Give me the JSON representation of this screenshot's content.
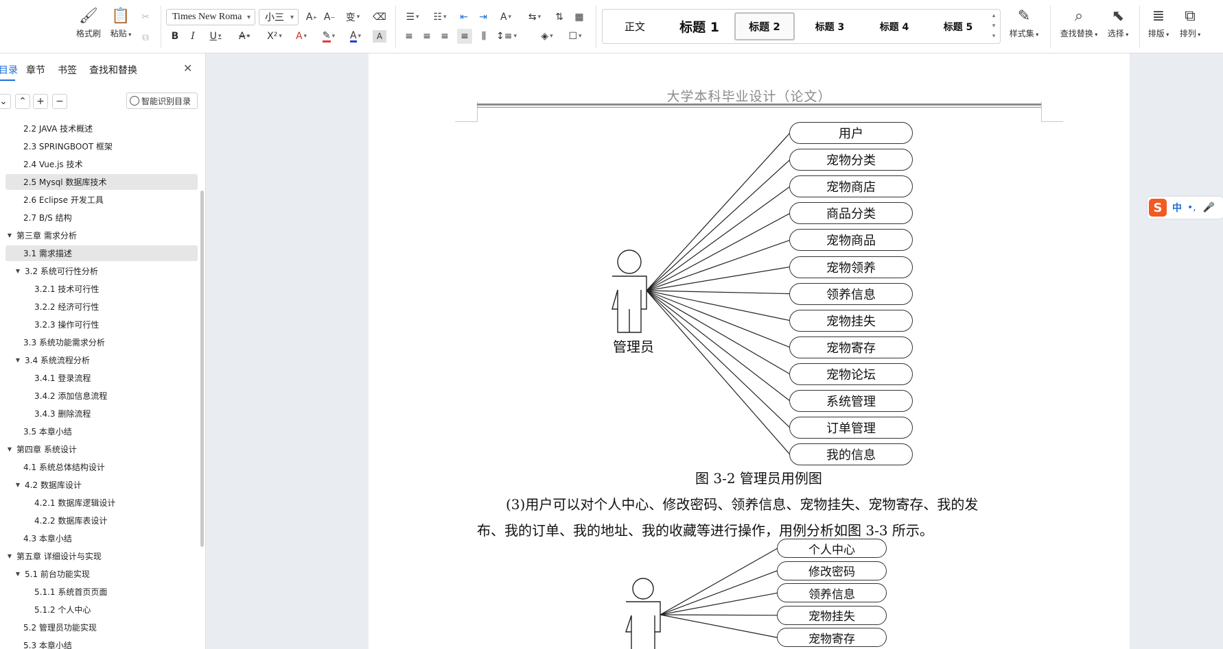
{
  "ribbon": {
    "format_painter": "格式刷",
    "paste": "粘贴",
    "font_name": "Times New Roma",
    "font_size": "小三",
    "styles": [
      "正文",
      "标题 1",
      "标题 2",
      "标题 3",
      "标题 4",
      "标题 5"
    ],
    "style_set": "样式集",
    "find_replace": "查找替换",
    "select": "选择",
    "layout": "排版",
    "arrange": "排列"
  },
  "nav": {
    "tabs": [
      "目录",
      "章节",
      "书签",
      "查找和替换"
    ],
    "smart_toc": "智能识别目录",
    "items": [
      {
        "label": "2.2 JAVA 技术概述",
        "level": 2
      },
      {
        "label": "2.3 SPRINGBOOT  框架",
        "level": 2
      },
      {
        "label": "2.4 Vue.js 技术",
        "level": 2
      },
      {
        "label": "2.5 Mysql 数据库技术",
        "level": 2,
        "highlight": true
      },
      {
        "label": "2.6 Eclipse 开发工具",
        "level": 2
      },
      {
        "label": "2.7 B/S 结构",
        "level": 2
      },
      {
        "label": "第三章  需求分析",
        "level": 1,
        "expanded": true
      },
      {
        "label": "3.1  需求描述",
        "level": 2,
        "highlight": true
      },
      {
        "label": "3.2  系统可行性分析",
        "level": 2,
        "expanded": true
      },
      {
        "label": "3.2.1 技术可行性",
        "level": 3
      },
      {
        "label": "3.2.2  经济可行性",
        "level": 3
      },
      {
        "label": "3.2.3  操作可行性",
        "level": 3
      },
      {
        "label": "3.3  系统功能需求分析",
        "level": 2
      },
      {
        "label": "3.4  系统流程分析",
        "level": 2,
        "expanded": true
      },
      {
        "label": "3.4.1  登录流程",
        "level": 3
      },
      {
        "label": "3.4.2  添加信息流程",
        "level": 3
      },
      {
        "label": "3.4.3  删除流程",
        "level": 3
      },
      {
        "label": "3.5  本章小结",
        "level": 2
      },
      {
        "label": "第四章  系统设计",
        "level": 1,
        "expanded": true
      },
      {
        "label": "4.1  系统总体结构设计",
        "level": 2
      },
      {
        "label": "4.2  数据库设计",
        "level": 2,
        "expanded": true
      },
      {
        "label": "4.2.1  数据库逻辑设计",
        "level": 3
      },
      {
        "label": "4.2.2  数据库表设计",
        "level": 3
      },
      {
        "label": "4.3  本章小结",
        "level": 2
      },
      {
        "label": "第五章  详细设计与实现",
        "level": 1,
        "expanded": true
      },
      {
        "label": "5.1  前台功能实现",
        "level": 2,
        "expanded": true
      },
      {
        "label": "5.1.1  系统首页页面",
        "level": 3
      },
      {
        "label": "5.1.2 个人中心",
        "level": 3
      },
      {
        "label": "5.2 管理员功能实现",
        "level": 2
      },
      {
        "label": "5.3  本章小结",
        "level": 2
      }
    ]
  },
  "document": {
    "header": "大学本科毕业设计（论文）",
    "diagram1": {
      "actor": "管理员",
      "use_cases": [
        "用户",
        "宠物分类",
        "宠物商店",
        "商品分类",
        "宠物商品",
        "宠物领养",
        "领养信息",
        "宠物挂失",
        "宠物寄存",
        "宠物论坛",
        "系统管理",
        "订单管理",
        "我的信息"
      ]
    },
    "caption1": "图 3-2  管理员用例图",
    "para_line1": "(3)用户可以对个人中心、修改密码、领养信息、宠物挂失、宠物寄存、我的发",
    "para_line2": "布、我的订单、我的地址、我的收藏等进行操作，用例分析如图 3-3 所示。",
    "diagram2": {
      "use_cases": [
        "个人中心",
        "修改密码",
        "领养信息",
        "宠物挂失",
        "宠物寄存"
      ]
    }
  },
  "ime": {
    "mode": "中",
    "punct": "•,"
  }
}
